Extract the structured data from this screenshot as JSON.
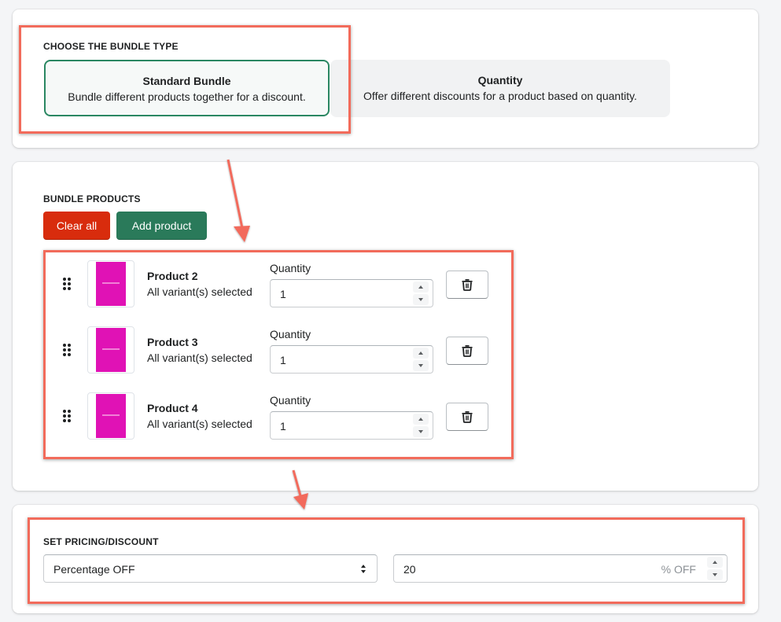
{
  "bundle_type": {
    "heading": "CHOOSE THE BUNDLE TYPE",
    "options": [
      {
        "title": "Standard Bundle",
        "description": "Bundle different products together for a discount.",
        "selected": true
      },
      {
        "title": "Quantity",
        "description": "Offer different discounts for a product based on quantity.",
        "selected": false
      }
    ]
  },
  "bundle_products": {
    "heading": "BUNDLE PRODUCTS",
    "clear_label": "Clear all",
    "add_label": "Add product",
    "products": [
      {
        "name": "Product 2",
        "variants": "All variant(s) selected",
        "quantity_label": "Quantity",
        "quantity": "1"
      },
      {
        "name": "Product 3",
        "variants": "All variant(s) selected",
        "quantity_label": "Quantity",
        "quantity": "1"
      },
      {
        "name": "Product 4",
        "variants": "All variant(s) selected",
        "quantity_label": "Quantity",
        "quantity": "1"
      }
    ]
  },
  "pricing": {
    "heading": "SET PRICING/DISCOUNT",
    "discount_type": "Percentage OFF",
    "discount_value": "20",
    "discount_suffix": "% OFF"
  },
  "icons": {
    "drag": "drag-handle-icon",
    "delete": "trash-icon",
    "select_arrows": "select-arrows-icon"
  },
  "colors": {
    "selected_border": "#2a8762",
    "clear_button": "#d82c0d",
    "add_button": "#2a7a5a",
    "highlight": "#f26b5b",
    "product_thumb": "#e012b5"
  }
}
